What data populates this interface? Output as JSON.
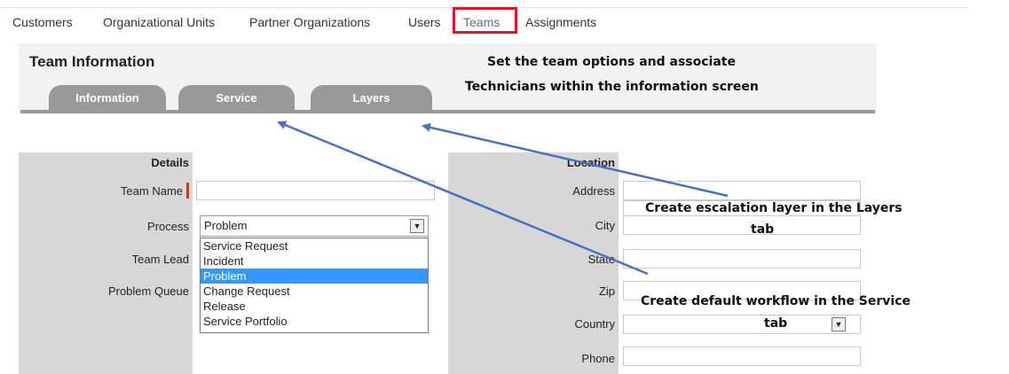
{
  "nav": {
    "items": [
      "Customers",
      "Organizational Units",
      "Partner Organizations",
      "Users",
      "Teams",
      "Assignments"
    ],
    "active": "Teams"
  },
  "panel": {
    "title": "Team Information",
    "tabs": [
      "Information",
      "Service",
      "Layers"
    ]
  },
  "notes": {
    "team_options_line1": "Set the team options and associate",
    "team_options_line2": "Technicians within the information screen",
    "layers_line1": "Create escalation layer in the Layers",
    "layers_line2": "tab",
    "service_line1": "Create default workflow in the Service",
    "service_line2": "tab"
  },
  "details": {
    "header": "Details",
    "team_name_label": "Team Name",
    "process_label": "Process",
    "process_value": "Problem",
    "team_lead_label": "Team Lead",
    "problem_queue_label": "Problem Queue",
    "process_options": [
      "Service Request",
      "Incident",
      "Problem",
      "Change Request",
      "Release",
      "Service Portfolio"
    ],
    "selected_option": "Problem"
  },
  "location": {
    "header": "Location",
    "address_label": "Address",
    "city_label": "City",
    "state_label": "State",
    "zip_label": "Zip",
    "country_label": "Country",
    "phone_label": "Phone"
  },
  "colors": {
    "highlight": "#e0161e",
    "arrow": "#4a6fbf",
    "tab": "#999999",
    "selected": "#3399ff"
  }
}
